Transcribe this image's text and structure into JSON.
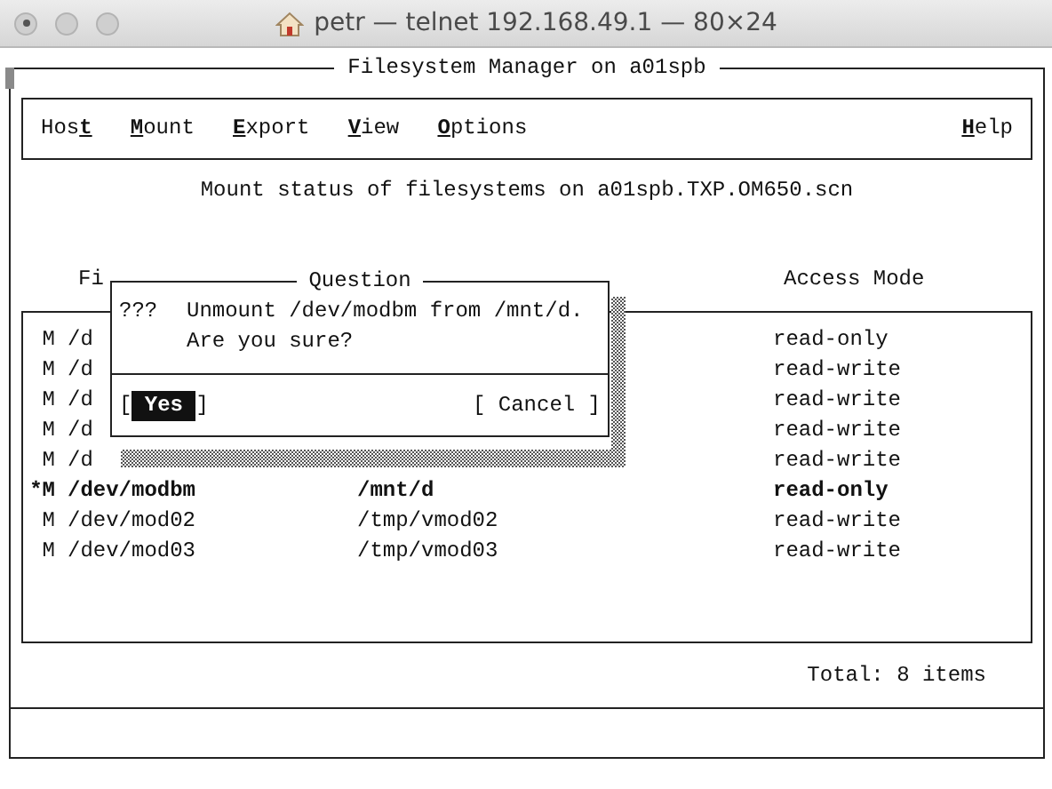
{
  "window": {
    "title": "petr — telnet 192.168.49.1 — 80×24"
  },
  "screen": {
    "title": "Filesystem Manager on a01spb",
    "menu": [
      {
        "pre": "Hos",
        "key": "t"
      },
      {
        "key": "M",
        "post": "ount"
      },
      {
        "key": "E",
        "post": "xport"
      },
      {
        "key": "V",
        "post": "iew"
      },
      {
        "key": "O",
        "post": "ptions"
      }
    ],
    "help_menu": {
      "key": "H",
      "post": "elp"
    },
    "heading": "Mount status of filesystems on a01spb.TXP.OM650.scn",
    "table": {
      "column_1": "Fi",
      "access_mode": "Access Mode",
      "rows": [
        {
          "marker": "M",
          "device": "/d",
          "access_mode": "read-only",
          "selected": false
        },
        {
          "marker": "M",
          "device": "/d",
          "access_mode": "read-write",
          "selected": false
        },
        {
          "marker": "M",
          "device": "/d",
          "access_mode": "read-write",
          "selected": false
        },
        {
          "marker": "M",
          "device": "/d",
          "access_mode": "read-write",
          "selected": false
        },
        {
          "marker": "M",
          "device": "/d",
          "access_mode": "read-write",
          "selected": false
        },
        {
          "marker": "*M",
          "device": "/dev/modbm",
          "mount_point": "/mnt/d",
          "access_mode": "read-only",
          "selected": true
        },
        {
          "marker": "M",
          "device": "/dev/mod02",
          "mount_point": "/tmp/vmod02",
          "access_mode": "read-write",
          "selected": false
        },
        {
          "marker": "M",
          "device": "/dev/mod03",
          "mount_point": "/tmp/vmod03",
          "access_mode": "read-write",
          "selected": false
        }
      ],
      "total": "Total: 8 items"
    }
  },
  "dialog": {
    "title": "Question",
    "prompt": "???",
    "lines": [
      "Unmount /dev/modbm from /mnt/d.",
      "Are you sure?"
    ],
    "buttons": [
      {
        "open": "[",
        "label": "Yes",
        "close": "]",
        "selected": true
      },
      {
        "open": "[",
        "label": "Cancel",
        "close": "]",
        "selected": false
      }
    ]
  }
}
